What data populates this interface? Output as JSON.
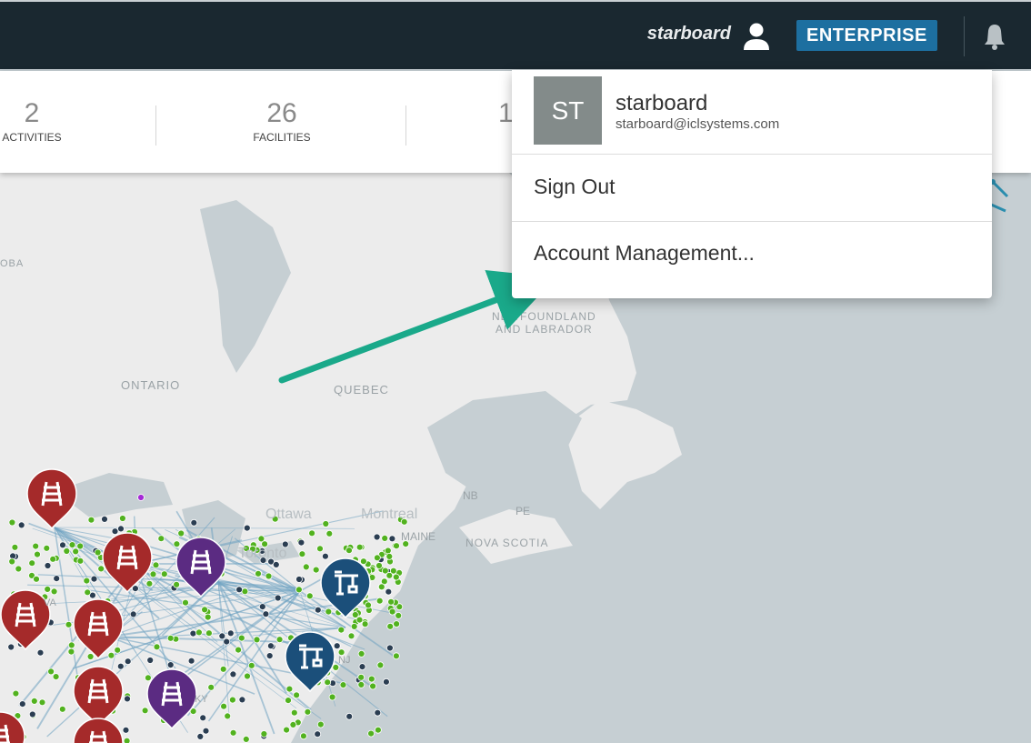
{
  "header": {
    "username": "starboard",
    "plan_badge": "ENTERPRISE",
    "icons": [
      "user-icon",
      "bell-icon"
    ]
  },
  "stats": [
    {
      "value": "2",
      "label": "ACTIVITIES"
    },
    {
      "value": "26",
      "label": "FACILITIES"
    },
    {
      "value": "1",
      "label": ""
    }
  ],
  "dropdown": {
    "avatar_initials": "ST",
    "name": "starboard",
    "email": "starboard@iclsystems.com",
    "items": [
      {
        "label": "Sign Out"
      },
      {
        "label": "Account Management..."
      }
    ]
  },
  "map": {
    "labels": {
      "ontario": "ONTARIO",
      "quebec": "QUEBEC",
      "nfl1": "NEWFOUNDLAND",
      "nfl2": "AND LABRADOR",
      "oba": "OBA",
      "ottawa": "Ottawa",
      "montreal": "Montreal",
      "toronto": "Toronto",
      "nb": "NB",
      "pe": "PE",
      "maine": "MAINE",
      "novascotia": "NOVA SCOTIA",
      "nj": "NJ",
      "ky": "KY",
      "va": "VA"
    }
  },
  "colors": {
    "topbar": "#1a2830",
    "badge": "#1d6fa0",
    "rail_marker": "#a52a2a",
    "purple_marker": "#5b2b82",
    "port_marker": "#1b4f7a",
    "dot_green": "#52b21f",
    "dot_navy": "#2b3e52",
    "arrow": "#1aa98a",
    "land": "#eeeeee",
    "water": "#c6cfd3"
  }
}
